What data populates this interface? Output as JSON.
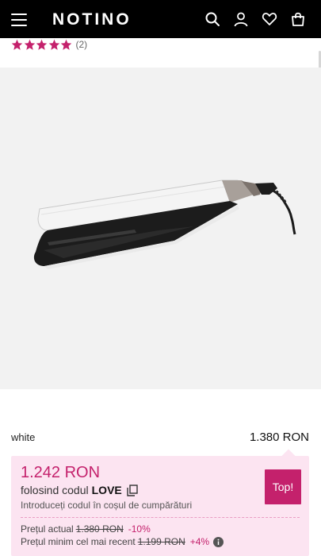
{
  "header": {
    "logo": "NOTINO",
    "background": "#000000",
    "icons": [
      "menu-icon",
      "search-icon",
      "user-icon",
      "heart-icon",
      "bag-icon"
    ]
  },
  "rating": {
    "stars": 5,
    "count_label": "(2)",
    "star_color": "#c4216c"
  },
  "product_image": {
    "description_icon": "hair-straightener"
  },
  "variant": {
    "name": "white",
    "price": "1.380 RON"
  },
  "promo": {
    "price": "1.242 RON",
    "code_prefix": "folosind codul",
    "code": "LOVE",
    "hint": "Introduceți codul în coșul de cumpărături",
    "badge": "Top!",
    "current_label": "Prețul actual",
    "current_old": "1.380 RON",
    "current_pct": "-10%",
    "min_label": "Prețul minim cel mai recent",
    "min_old": "1.199 RON",
    "min_pct": "+4%",
    "accent": "#c4216c",
    "background": "#fce4f1"
  }
}
